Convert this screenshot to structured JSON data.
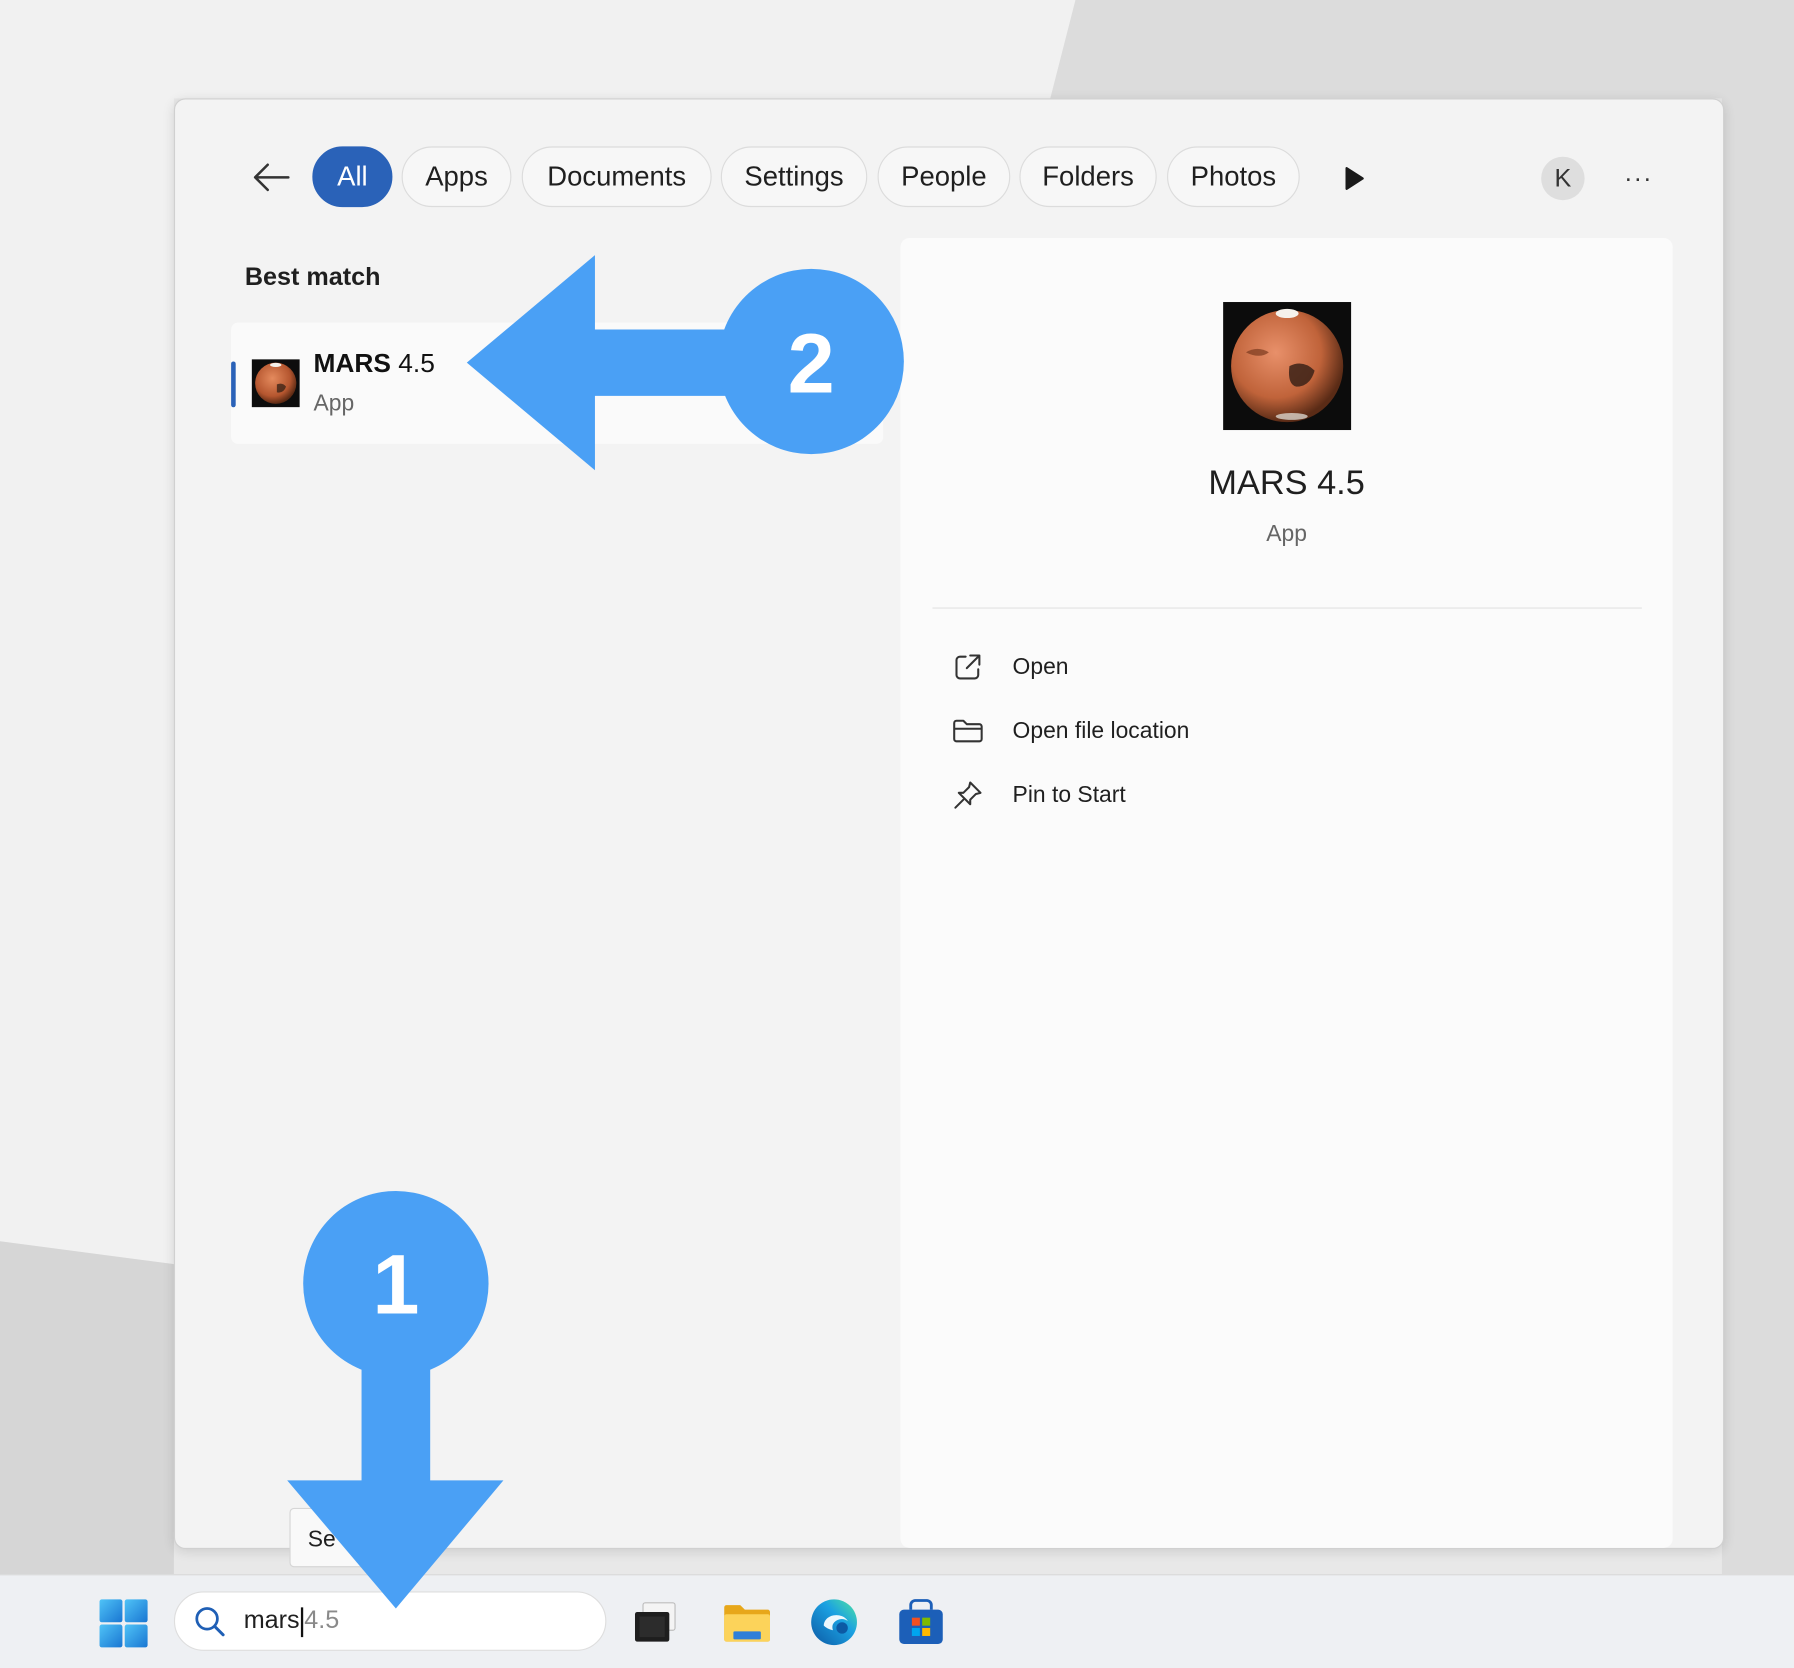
{
  "filter_tabs": [
    {
      "label": "All",
      "active": true
    },
    {
      "label": "Apps",
      "active": false
    },
    {
      "label": "Documents",
      "active": false
    },
    {
      "label": "Settings",
      "active": false
    },
    {
      "label": "People",
      "active": false
    },
    {
      "label": "Folders",
      "active": false
    },
    {
      "label": "Photos",
      "active": false
    }
  ],
  "account": {
    "initial": "K"
  },
  "overflow_label": "···",
  "best_match": {
    "title": "Best match",
    "item": {
      "name_bold": "MARS",
      "name_rest": " 4.5",
      "type": "App"
    }
  },
  "details": {
    "name": "MARS 4.5",
    "type": "App",
    "actions": [
      {
        "label": "Open",
        "icon": "open-icon"
      },
      {
        "label": "Open file location",
        "icon": "folder-icon"
      },
      {
        "label": "Pin to Start",
        "icon": "pin-icon"
      }
    ]
  },
  "taskbar": {
    "search_typed": "mars",
    "search_suggestion": "4.5",
    "tooltip_text": "Se",
    "apps": [
      "task-view-icon",
      "file-explorer-icon",
      "edge-icon",
      "store-icon"
    ]
  },
  "annotations": [
    {
      "number": "1",
      "color": "#4aa0f5"
    },
    {
      "number": "2",
      "color": "#4aa0f5"
    }
  ],
  "colors": {
    "accent": "#2a62b8",
    "annotation": "#4aa0f5"
  }
}
